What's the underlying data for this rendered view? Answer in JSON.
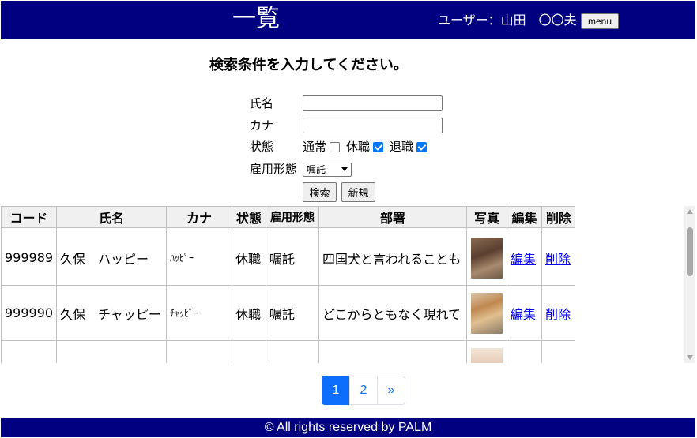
{
  "header": {
    "title": "一覧",
    "user_label": "ユーザー：山田　〇〇夫",
    "menu_button": "menu"
  },
  "search": {
    "heading": "検索条件を入力してください。",
    "name_label": "氏名",
    "name_value": "",
    "kana_label": "カナ",
    "kana_value": "",
    "status_label": "状態",
    "status_options": [
      {
        "label": "通常",
        "checked": false
      },
      {
        "label": "休職",
        "checked": true
      },
      {
        "label": "退職",
        "checked": true
      }
    ],
    "employment_label": "雇用形態",
    "employment_selected": "嘱託",
    "search_button": "検索",
    "new_button": "新規"
  },
  "table": {
    "headers": [
      "コード",
      "氏名",
      "カナ",
      "状態",
      "雇用形態",
      "部署",
      "写真",
      "編集",
      "削除"
    ],
    "rows": [
      {
        "code": "999989",
        "name": "久保　ハッピー",
        "kana": "ﾊｯﾋﾟｰ",
        "status": "休職",
        "employment": "嘱託",
        "dept": "四国犬と言われることも",
        "photo": "shikoku-dog-photo",
        "edit": "編集",
        "delete": "削除"
      },
      {
        "code": "999990",
        "name": "久保　チャッピー",
        "kana": "ﾁｬｯﾋﾟｰ",
        "status": "休職",
        "employment": "嘱託",
        "dept": "どこからともなく現れて",
        "photo": "shiba-dog-photo",
        "edit": "編集",
        "delete": "削除"
      }
    ]
  },
  "pagination": {
    "pages": [
      "1",
      "2"
    ],
    "current": "1",
    "next": "»"
  },
  "footer": {
    "text": "© All rights reserved by PALM"
  },
  "colors": {
    "header_bg": "#000080",
    "active_page": "#0d6efd"
  }
}
